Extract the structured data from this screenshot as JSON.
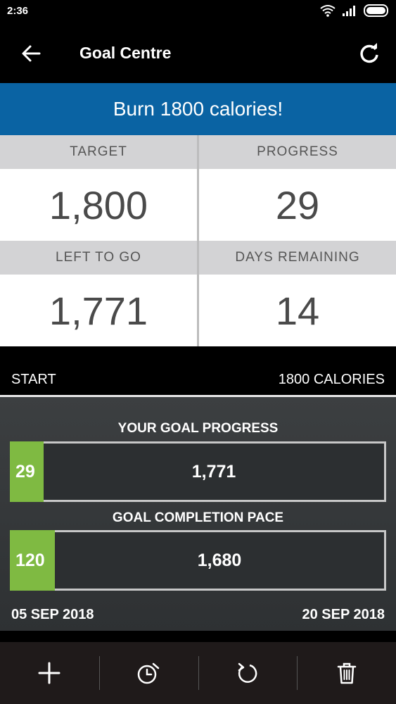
{
  "status_bar": {
    "time": "2:36"
  },
  "app_bar": {
    "title": "Goal Centre",
    "back_icon": "arrow-left-icon",
    "refresh_icon": "refresh-icon"
  },
  "banner": {
    "text": "Burn 1800 calories!",
    "color": "#0a63a3"
  },
  "stats": {
    "target": {
      "label": "TARGET",
      "value": "1,800"
    },
    "progress": {
      "label": "PROGRESS",
      "value": "29"
    },
    "left_to_go": {
      "label": "LEFT TO GO",
      "value": "1,771"
    },
    "days_remaining": {
      "label": "DAYS REMAINING",
      "value": "14"
    }
  },
  "range": {
    "start": "START",
    "end": "1800 CALORIES"
  },
  "goal_progress": {
    "title": "YOUR GOAL PROGRESS",
    "done": "29",
    "remaining": "1,771",
    "done_fraction": 0.0161
  },
  "completion_pace": {
    "title": "GOAL COMPLETION PACE",
    "done": "120",
    "remaining": "1,680",
    "done_fraction": 0.0667
  },
  "dates": {
    "start": "05 SEP 2018",
    "end": "20 SEP 2018"
  },
  "accent_green": "#7fba42",
  "bottom_bar": [
    "plus-icon",
    "alarm-clock-icon",
    "reset-icon",
    "trash-icon"
  ]
}
